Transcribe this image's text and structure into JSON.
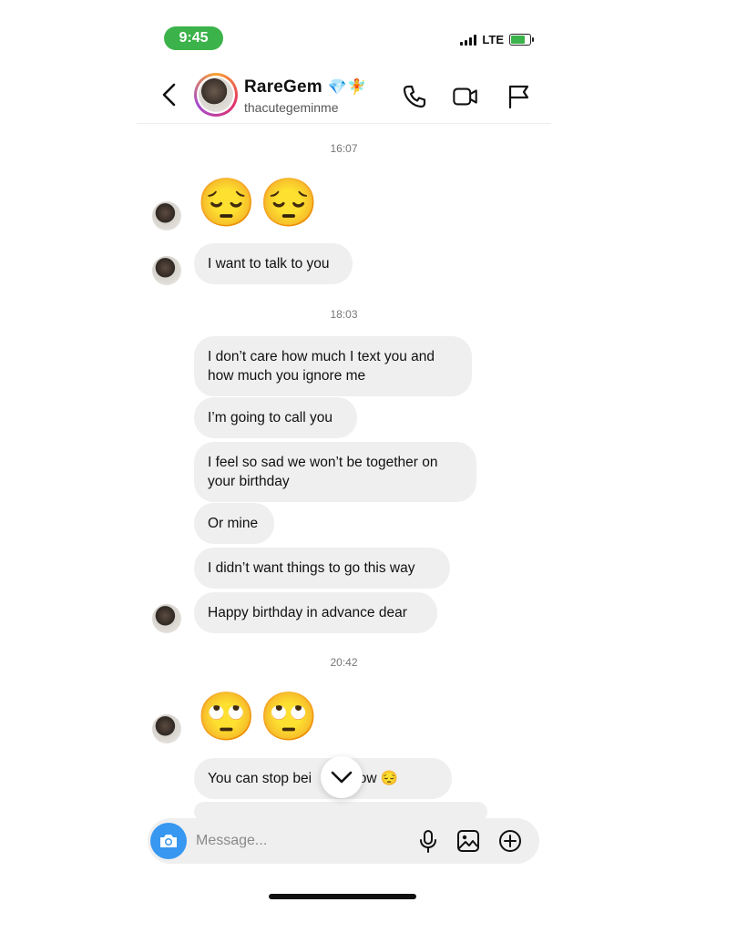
{
  "status_bar": {
    "time": "9:45",
    "network": "LTE"
  },
  "header": {
    "name": "RareGem",
    "name_emoji": "💎🧚",
    "handle": "thacutegeminme"
  },
  "messages": {
    "ts1": "16:07",
    "emoji1": "😔😔",
    "m1": "I want to talk to you",
    "ts2": "18:03",
    "m2": "I don’t care how much I text you and how much you ignore me",
    "m3": "I’m going to call you",
    "m4": "I feel so sad we won’t be together on your birthday",
    "m5": "Or mine",
    "m6": "I didn’t want things to go this way",
    "m7": "Happy birthday in advance dear",
    "ts3": "20:42",
    "emoji2": "🙄🙄",
    "m8": "You can stop bei     ud now 😔"
  },
  "composer": {
    "placeholder": "Message..."
  },
  "colors": {
    "status_green": "#3cb34a",
    "camera_blue": "#3897f0",
    "bubble_gray": "#efefef"
  }
}
